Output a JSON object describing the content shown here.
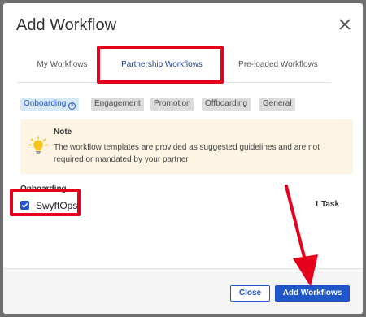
{
  "dialog": {
    "title": "Add Workflow"
  },
  "tabs": [
    {
      "label": "My Workflows",
      "active": false
    },
    {
      "label": "Partnership Workflows",
      "active": true
    },
    {
      "label": "Pre-loaded Workflows",
      "active": false
    }
  ],
  "filters": [
    {
      "label": "Onboarding",
      "active": true
    },
    {
      "label": "Engagement",
      "active": false
    },
    {
      "label": "Promotion",
      "active": false
    },
    {
      "label": "Offboarding",
      "active": false
    },
    {
      "label": "General",
      "active": false
    }
  ],
  "note": {
    "heading": "Note",
    "body": "The workflow templates are provided as suggested guidelines and are not required or mandated by your partner",
    "icon": "lightbulb-icon"
  },
  "section": {
    "label": "Onboarding",
    "items": [
      {
        "name": "SwyftOps",
        "checked": true,
        "tasks": "1 Task"
      }
    ]
  },
  "footer": {
    "close_label": "Close",
    "add_label": "Add Workflows"
  },
  "colors": {
    "accent": "#1f56c9",
    "highlight": "#e5001b",
    "note_bg": "#fdf4e3",
    "overlay": "#6e6e6e"
  }
}
